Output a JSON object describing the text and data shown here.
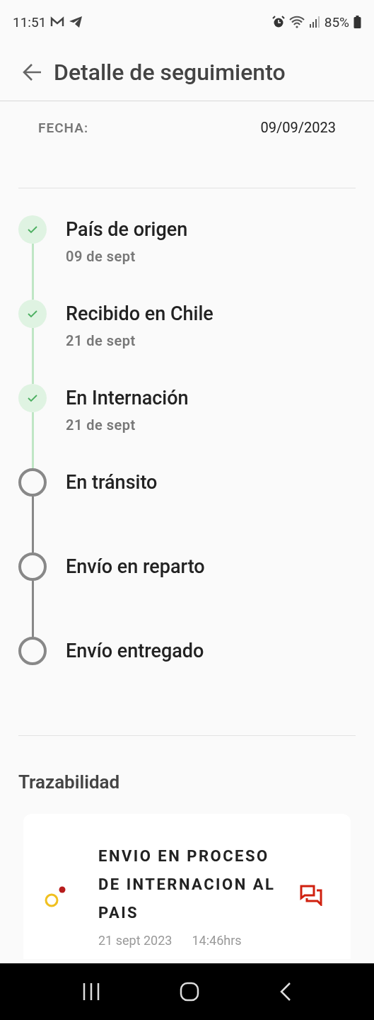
{
  "status_bar": {
    "time": "11:51",
    "battery": "85%"
  },
  "header": {
    "title": "Detalle de seguimiento"
  },
  "date_row": {
    "label": "FECHA:",
    "value": "09/09/2023"
  },
  "steps": [
    {
      "title": "País de origen",
      "date": "09 de sept",
      "completed": true
    },
    {
      "title": "Recibido en Chile",
      "date": "21 de sept",
      "completed": true
    },
    {
      "title": "En Internación",
      "date": "21 de sept",
      "completed": true
    },
    {
      "title": "En tránsito",
      "completed": false
    },
    {
      "title": "Envío en reparto",
      "completed": false
    },
    {
      "title": "Envío entregado",
      "completed": false
    }
  ],
  "traceability": {
    "heading": "Trazabilidad",
    "events": [
      {
        "title": "ENVIO EN PROCESO DE INTERNACION AL PAIS",
        "date": "21 sept 2023",
        "time": "14:46hrs"
      }
    ]
  }
}
